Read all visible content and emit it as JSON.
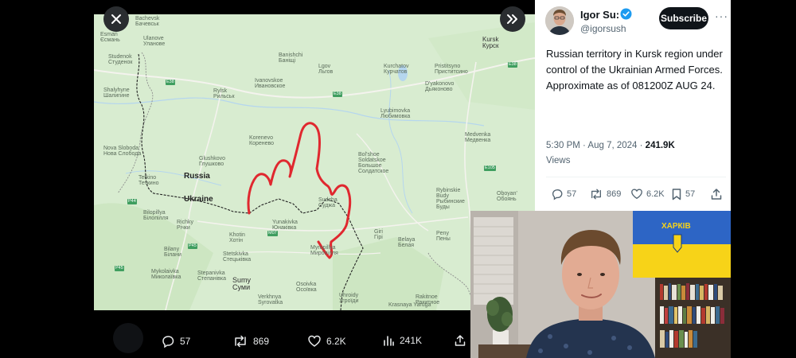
{
  "viewer": {
    "close_icon": "close-icon",
    "expand_icon": "expand-icon",
    "actions": {
      "replies": "57",
      "reposts": "869",
      "likes": "6.2K",
      "views": "241K"
    }
  },
  "map": {
    "countries": {
      "russia": "Russia",
      "ukraine": "Ukraine"
    },
    "towns": {
      "bachevsk": "Bachevsk\nБачевськ",
      "esman": "Esman\nЄсмань",
      "ulanove": "Ulanove\nУланове",
      "studenok": "Studenok\nСтуденок",
      "shalyhyne": "Shalyhyne\nШалигине",
      "nova_sloboda": "Nova Sloboda\nНова Слобода",
      "tetkino": "Tetkino\nТеткино",
      "bilopillya": "Bilopillya\nБілопілля",
      "richky": "Richky\nРічки",
      "bilany": "Bilany\nБілани",
      "mykolaivka": "Mykolaivka\nМиколаївка",
      "stepanivka": "Stepanivka\nСтепанівка",
      "sumy": "Sumy\nСуми",
      "verkhnya_syrovatka": "Verkhnya\nSyrovatka",
      "banishchi": "Banishchi\nБаніщі",
      "rylsk": "Rylsk\nРильськ",
      "ivanovskoe": "Ivanovskoe\nИвановское",
      "lgov": "Lgov\nЛьгов",
      "korenevo": "Korenevo\nКоренево",
      "glushkovo": "Glushkovo\nГлушково",
      "khotin": "Khotin\nХотін",
      "yunakivka": "Yunakivka\nЮнаківка",
      "stetskivka": "Stetskivka\nСтецьківка",
      "myropillya": "Myropillya\nМиропілля",
      "osoivka": "Osoivka\nОсоївка",
      "kurchatov": "Kurchatov\nКурчатов",
      "bolshoe_soldatskoe": "Bol'shoe\nSoldatskoe\nБольшое\nСолдатское",
      "lyubimovka": "Lyubimovka\nЛюбимовка",
      "sudzha": "Sudzha\nСуджа",
      "pristitsyno": "Pristitsyno\nПриститсино",
      "dyakonovo": "D'yakonovo\nДьяконово",
      "kursk": "Kursk\nКурск",
      "medvenka": "Medvenka\nМедвенка",
      "rybinskie_budy": "Rybinskie\nBudy\nРыбинские\nБуды",
      "oboyan": "Oboyan'\nОбоянь",
      "giri": "Giri\nГірі",
      "belaya": "Belaya\nБелая",
      "peny": "Peny\nПены",
      "krasnaya_yaruga": "Krasnaya Yaruga",
      "rakitnoe": "Rakitnoe\nРакитное",
      "uhroidy": "Uhroidy\nУгроїди"
    },
    "roads": [
      "E38",
      "E38",
      "E38",
      "E105",
      "P44",
      "P45",
      "M07",
      "P45"
    ]
  },
  "tweet": {
    "user_name": "Igor Su:",
    "handle": "@igorsush",
    "subscribe_label": "Subscribe",
    "more_label": "···",
    "text_lines": [
      "Russian territory in Kursk region under control of the Ukrainian Armed Forces.",
      "Approximate as of 081200Z AUG 24."
    ],
    "time": "5:30 PM · Aug 7, 2024 · ",
    "view_count": "241.9K",
    "views_label": "Views",
    "actions": {
      "replies": "57",
      "reposts": "869",
      "likes": "6.2K",
      "bookmarks": "57"
    }
  },
  "webcam": {
    "flag_text": "ХАРКІВ"
  },
  "colors": {
    "map_land": "#d8ecd0",
    "border_red": "#e0282f",
    "subscribe_bg": "#0f1419",
    "verified_blue": "#1d9bf0",
    "flag_blue": "#2d65c5",
    "flag_yellow": "#f7d318"
  }
}
